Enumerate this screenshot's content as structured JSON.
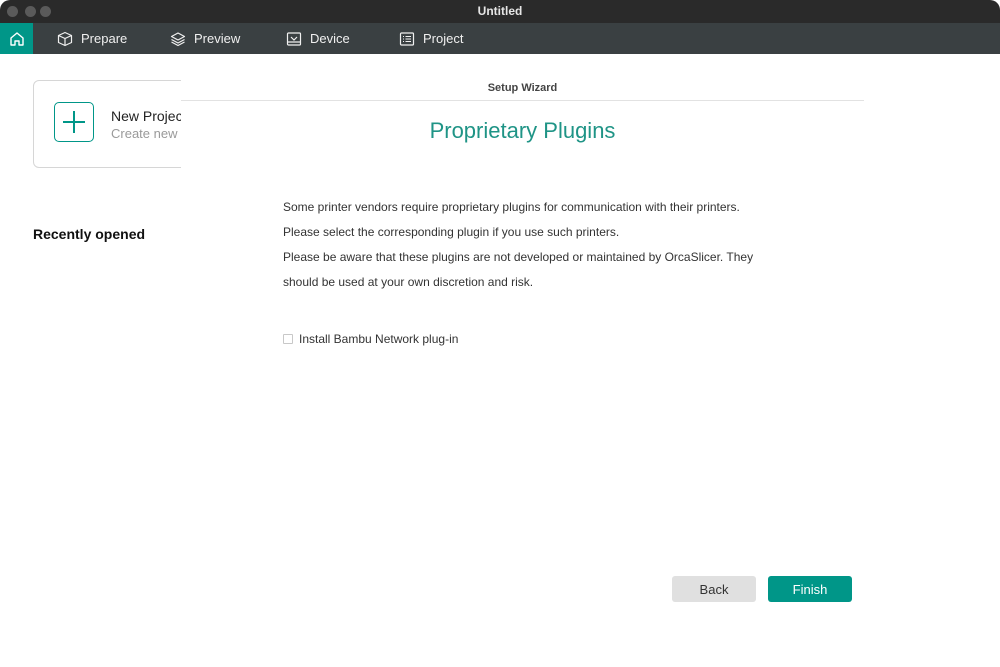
{
  "window": {
    "title": "Untitled"
  },
  "tabs": [
    {
      "label": "Prepare",
      "icon": "box-icon"
    },
    {
      "label": "Preview",
      "icon": "layers-icon"
    },
    {
      "label": "Device",
      "icon": "device-icon"
    },
    {
      "label": "Project",
      "icon": "list-icon"
    }
  ],
  "home": {
    "new_project_title": "New Project",
    "new_project_subtitle": "Create new",
    "recently_opened": "Recently opened"
  },
  "wizard": {
    "header": "Setup Wizard",
    "heading": "Proprietary Plugins",
    "paragraphs": [
      "Some printer vendors require proprietary plugins for communication with their printers.",
      "Please select the corresponding plugin if you use such printers.",
      "Please be aware that these plugins are not developed or maintained by OrcaSlicer. They",
      "should be used at your own discretion and risk."
    ],
    "checkbox_label": "Install Bambu Network plug-in",
    "checkbox_checked": false,
    "back_label": "Back",
    "finish_label": "Finish"
  },
  "colors": {
    "accent": "#009688",
    "tabbar": "#3a4042",
    "titlebar": "#2a2a2a"
  }
}
